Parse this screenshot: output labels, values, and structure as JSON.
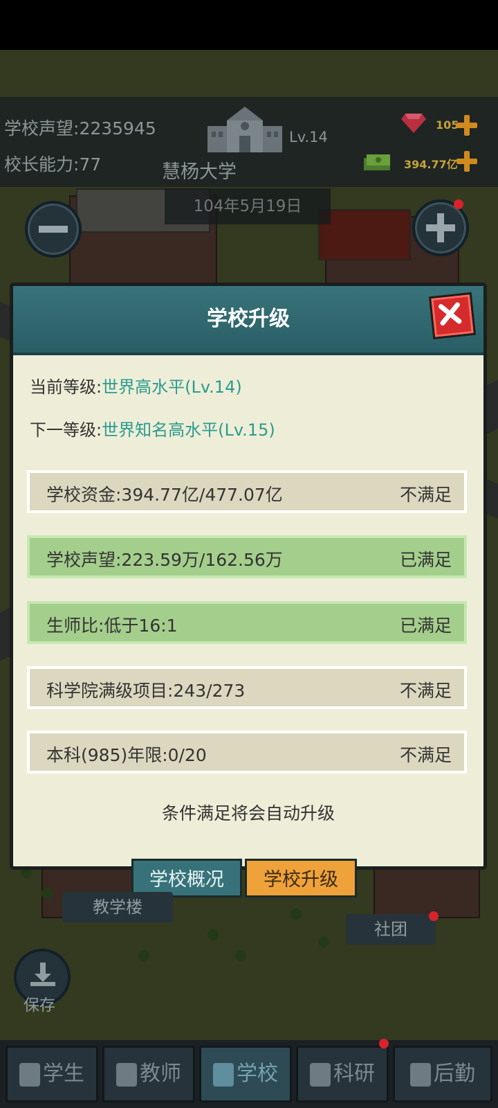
{
  "top": {
    "reputation_label": "学校声望:",
    "reputation_value": "2235945",
    "principal_label": "校长能力:",
    "principal_value": "77",
    "level": "Lv.14",
    "school_name": "慧杨大学",
    "gems": "105",
    "money": "394.77亿",
    "date": "104年5月19日"
  },
  "modal": {
    "title": "学校升级",
    "current_label": "当前等级:",
    "current_value": "世界高水平(Lv.14)",
    "next_label": "下一等级:",
    "next_value": "世界知名高水平(Lv.15)",
    "requirements": [
      {
        "label": "学校资金:394.77亿/477.07亿",
        "status": "不满足",
        "met": false
      },
      {
        "label": "学校声望:223.59万/162.56万",
        "status": "已满足",
        "met": true
      },
      {
        "label": "生师比:低于16:1",
        "status": "已满足",
        "met": true
      },
      {
        "label": "科学院满级项目:243/273",
        "status": "不满足",
        "met": false
      },
      {
        "label": "本科(985)年限:0/20",
        "status": "不满足",
        "met": false
      }
    ],
    "footer_note": "条件满足将会自动升级"
  },
  "panel_tabs": {
    "overview": "学校概况",
    "upgrade": "学校升级"
  },
  "map_labels": {
    "teaching_building": "教学楼",
    "club": "社团"
  },
  "save_label": "保存",
  "nav": {
    "student": "学生",
    "teacher": "教师",
    "school": "学校",
    "research": "科研",
    "logistics": "后勤"
  },
  "colors": {
    "accent_teal": "#2a9b8e",
    "met_green": "#a4ce8c",
    "close_red": "#d52b2c",
    "active_tab": "#f0a23a"
  }
}
